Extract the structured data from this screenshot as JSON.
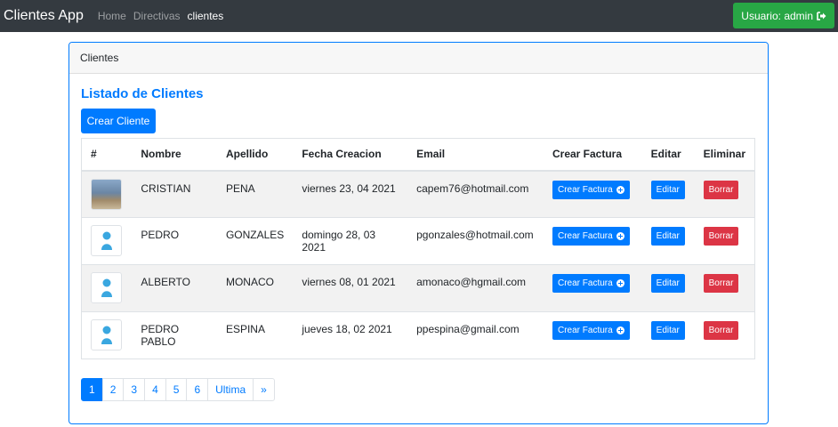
{
  "navbar": {
    "brand": "Clientes App",
    "links": [
      "Home",
      "Directivas",
      "clientes"
    ],
    "user_button": "Usuario: admin"
  },
  "card": {
    "header": "Clientes",
    "title": "Listado de Clientes",
    "create_button": "Crear Cliente"
  },
  "table": {
    "headers": [
      "#",
      "Nombre",
      "Apellido",
      "Fecha Creacion",
      "Email",
      "Crear Factura",
      "Editar",
      "Eliminar"
    ],
    "rows": [
      {
        "photo": "photo",
        "nombre": "CRISTIAN",
        "apellido": "PENA",
        "fecha": "viernes 23, 04 2021",
        "email": "capem76@hotmail.com"
      },
      {
        "photo": "avatar",
        "nombre": "PEDRO",
        "apellido": "GONZALES",
        "fecha": "domingo 28, 03 2021",
        "email": "pgonzales@hotmail.com"
      },
      {
        "photo": "avatar",
        "nombre": "ALBERTO",
        "apellido": "MONACO",
        "fecha": "viernes 08, 01 2021",
        "email": "amonaco@hgmail.com"
      },
      {
        "photo": "avatar",
        "nombre": "PEDRO PABLO",
        "apellido": "ESPINA",
        "fecha": "jueves 18, 02 2021",
        "email": "ppespina@gmail.com"
      }
    ],
    "crear_factura_label": "Crear Factura",
    "editar_label": "Editar",
    "borrar_label": "Borrar"
  },
  "pagination": {
    "pages": [
      "1",
      "2",
      "3",
      "4",
      "5",
      "6",
      "Ultima",
      "»"
    ],
    "active": "1"
  },
  "colors": {
    "primary": "#007bff",
    "success": "#28a745",
    "danger": "#dc3545",
    "navbar": "#343a40"
  }
}
